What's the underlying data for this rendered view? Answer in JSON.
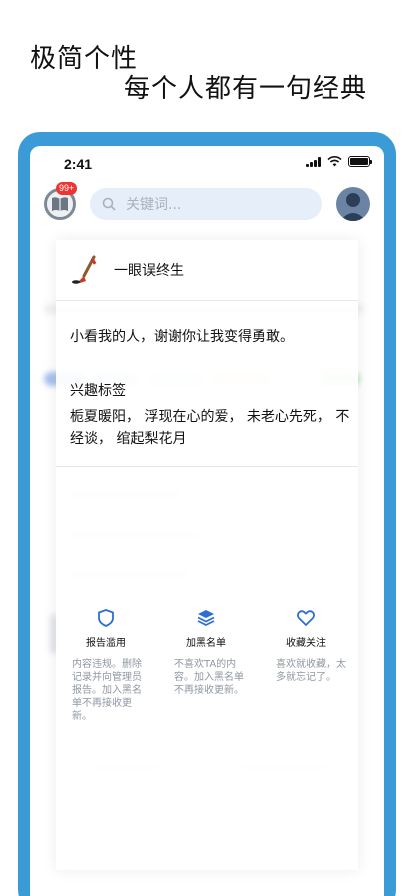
{
  "headline": {
    "line1": "极简个性",
    "line2": "每个人都有一句经典"
  },
  "status_bar": {
    "time": "2:41"
  },
  "top_bar": {
    "badge": "99+",
    "search_placeholder": "关键词..."
  },
  "card": {
    "user_name": "一眼误终生",
    "quote": "小看我的人，谢谢你让我变得勇敢。",
    "tags_title": "兴趣标签",
    "tags_text": "栀夏暖阳， 浮现在心的爱， 未老心先死， 不经谈， 绾起梨花月"
  },
  "actions": [
    {
      "label": "报告滥用",
      "icon": "shield-icon",
      "desc": "内容违规。删除记录并向管理员报告。加入黑名单不再接收更新。"
    },
    {
      "label": "加黑名单",
      "icon": "layers-icon",
      "desc": "不喜欢TA的内容。加入黑名单不再接收更新。"
    },
    {
      "label": "收藏关注",
      "icon": "heart-icon",
      "desc": "喜欢就收藏，太多就忘记了。"
    }
  ],
  "colors": {
    "frame": "#3a9bd6",
    "accent": "#2d6fd0",
    "search_bg": "#e6eef9"
  }
}
